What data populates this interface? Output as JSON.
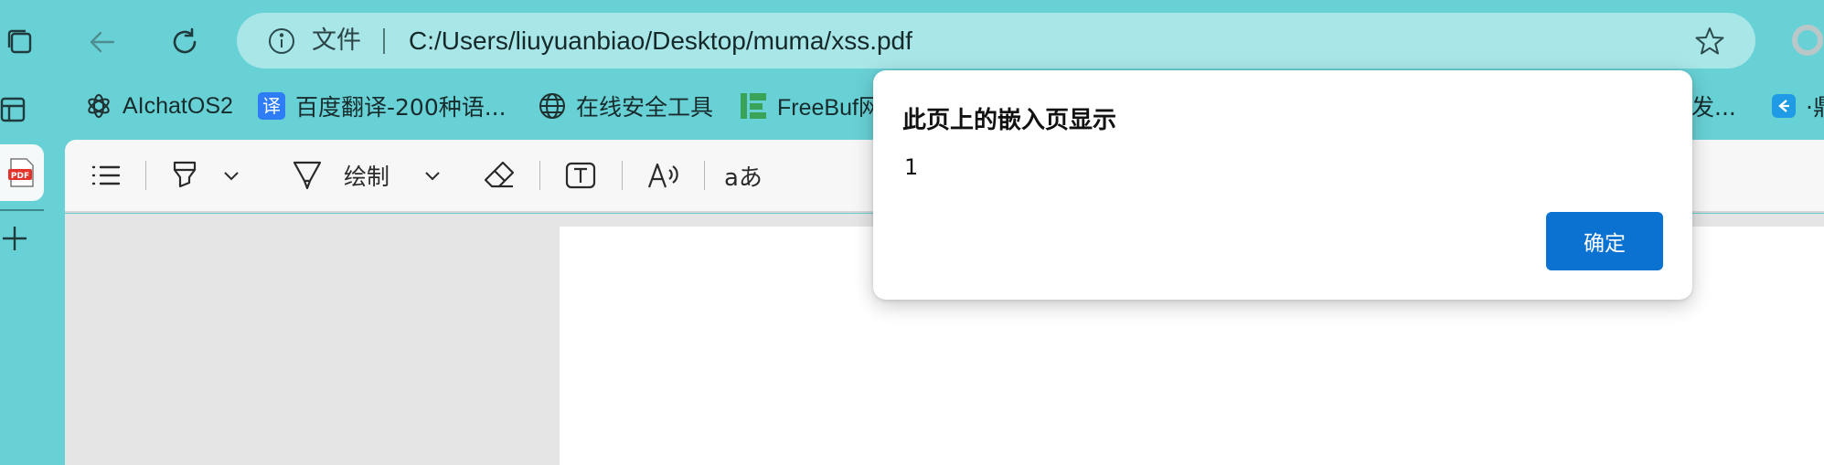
{
  "address_bar": {
    "security_label": "文件",
    "url": "C:/Users/liuyuanbiao/Desktop/muma/xss.pdf"
  },
  "bookmarks": [
    {
      "label": "AIchatOS2",
      "icon": "openai-icon"
    },
    {
      "label": "百度翻译-200种语...",
      "icon": "translate-icon"
    },
    {
      "label": "在线安全工具",
      "icon": "globe-icon"
    },
    {
      "label": "FreeBuf网",
      "icon": "freebuf-icon"
    },
    {
      "label": "发...",
      "icon": ""
    },
    {
      "label": "·鼎",
      "icon": "bookmark-e-icon"
    }
  ],
  "pdf_toolbar": {
    "draw_label": "绘制",
    "translate_glyph": "aあ",
    "read_aloud_glyph": "A⁾)"
  },
  "dialog": {
    "title": "此页上的嵌入页显示",
    "message": "1",
    "ok_label": "确定"
  },
  "colors": {
    "frame": "#68d1d6",
    "address_bar": "#a8e6e8",
    "accent_button": "#0b72d1"
  }
}
